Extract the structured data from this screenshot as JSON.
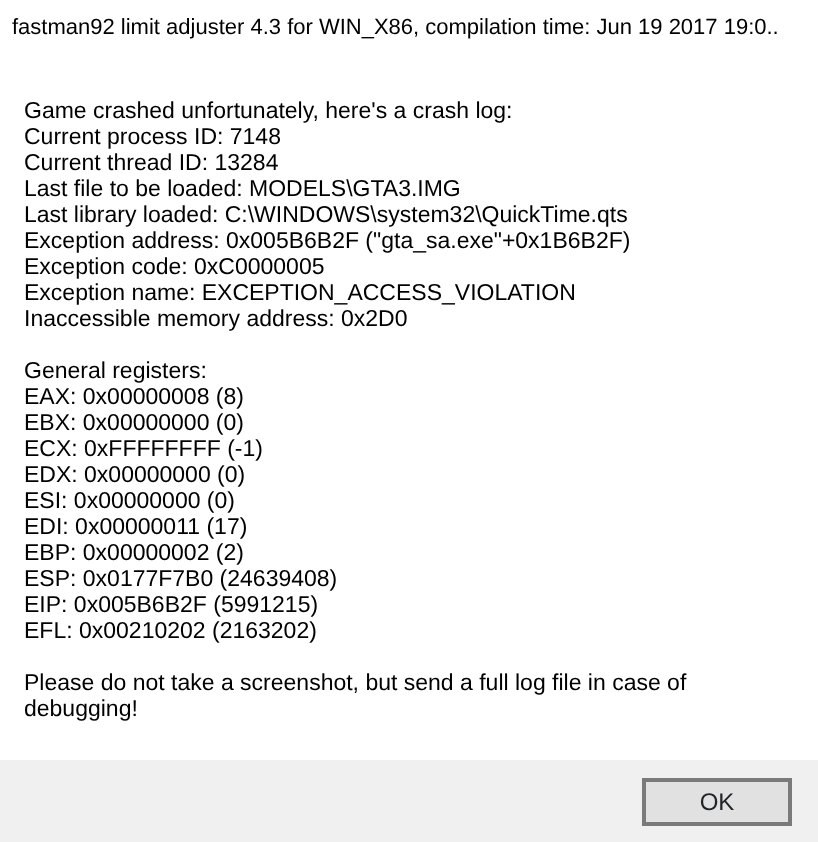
{
  "window": {
    "title": "fastman92 limit adjuster 4.3 for WIN_X86, compilation time: Jun 19 2017 19:0.."
  },
  "message_groups": [
    [
      "Game crashed unfortunately, here's a crash log:",
      "Current process ID: 7148",
      "Current thread ID: 13284",
      "Last file to be loaded: MODELS\\GTA3.IMG",
      "Last library loaded: C:\\WINDOWS\\system32\\QuickTime.qts",
      "Exception address: 0x005B6B2F (\"gta_sa.exe\"+0x1B6B2F)",
      "Exception code: 0xC0000005",
      "Exception name: EXCEPTION_ACCESS_VIOLATION",
      "Inaccessible memory address: 0x2D0"
    ],
    [
      "General registers:",
      "EAX: 0x00000008 (8)",
      "EBX: 0x00000000 (0)",
      "ECX: 0xFFFFFFFF (-1)",
      "EDX: 0x00000000 (0)",
      "ESI: 0x00000000 (0)",
      "EDI: 0x00000011 (17)",
      "EBP: 0x00000002 (2)",
      "ESP: 0x0177F7B0 (24639408)",
      "EIP: 0x005B6B2F (5991215)",
      "EFL: 0x00210202 (2163202)"
    ],
    [
      "Please do not take a screenshot, but send a full log file in case of debugging!"
    ]
  ],
  "buttons": [
    "OK"
  ]
}
